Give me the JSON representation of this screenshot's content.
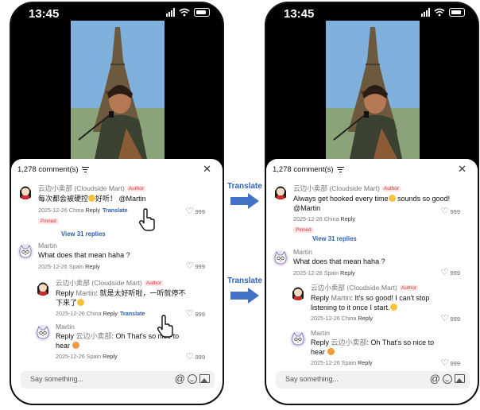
{
  "status_time": "13:45",
  "arrow_label": "Translate",
  "left": {
    "header": "1,278 comment(s)",
    "c1": {
      "name": "云边小卖部 (Cloudside Mart)",
      "tag": "Author",
      "text_a": "每次都会被硬控",
      "text_b": "好听！ @Martin",
      "date": "2025-12-26 China",
      "reply": "Reply",
      "translate": "Translate",
      "likes": "999",
      "pinned": "Pinned",
      "view_replies": "View 31 replies"
    },
    "c2": {
      "name": "Martin",
      "text": "What does that mean haha ?",
      "date": "2025-12-26 Spain",
      "reply": "Reply",
      "likes": "999"
    },
    "c3": {
      "name": "云边小卖部 (Cloudside Mart)",
      "tag": "Author",
      "text_a": "Reply ",
      "text_to": "Martin",
      "text_b": ": 就是太好听啦，一听就停不",
      "text_c": "下来了",
      "date": "2025-12-26 China",
      "reply": "Reply",
      "translate": "Translate",
      "likes": "999"
    },
    "c4": {
      "name": "Martin",
      "text_a": "Reply ",
      "text_to": "云边小卖部",
      "text_b": ": Oh That's so nice to",
      "text_c": "hear",
      "date": "2025-12-26 Spain",
      "reply": "Reply",
      "likes": "999"
    },
    "input_placeholder": "Say something..."
  },
  "right": {
    "header": "1,278 comment(s)",
    "c1": {
      "name": "云边小卖部 (Cloudside Mart)",
      "tag": "Author",
      "text_a": "Always get hooked every time",
      "text_b": " sounds so good!",
      "text_c": "@Martin",
      "date": "2025-12-26 China",
      "reply": "Reply",
      "likes": "999",
      "pinned": "Pinned",
      "view_replies": "View 31 replies"
    },
    "c2": {
      "name": "Martin",
      "text": "What does that mean haha ?",
      "date": "2025-12-26 Spain",
      "reply": "Reply",
      "likes": "999"
    },
    "c3": {
      "name": "云边小卖部 (Cloudside Mart)",
      "tag": "Author",
      "text_a": "Reply ",
      "text_to": "Martin",
      "text_b": ": It's so good! I can't stop",
      "text_c": "listening to it once I start.",
      "date": "2025-12-26 China",
      "reply": "Reply",
      "likes": "999"
    },
    "c4": {
      "name": "Martin",
      "text_a": "Reply ",
      "text_to": "云边小卖部",
      "text_b": ": Oh That's so nice to",
      "text_c": "hear",
      "date": "2025-12-26 Spain",
      "reply": "Reply",
      "likes": "999"
    },
    "input_placeholder": "Say something..."
  }
}
